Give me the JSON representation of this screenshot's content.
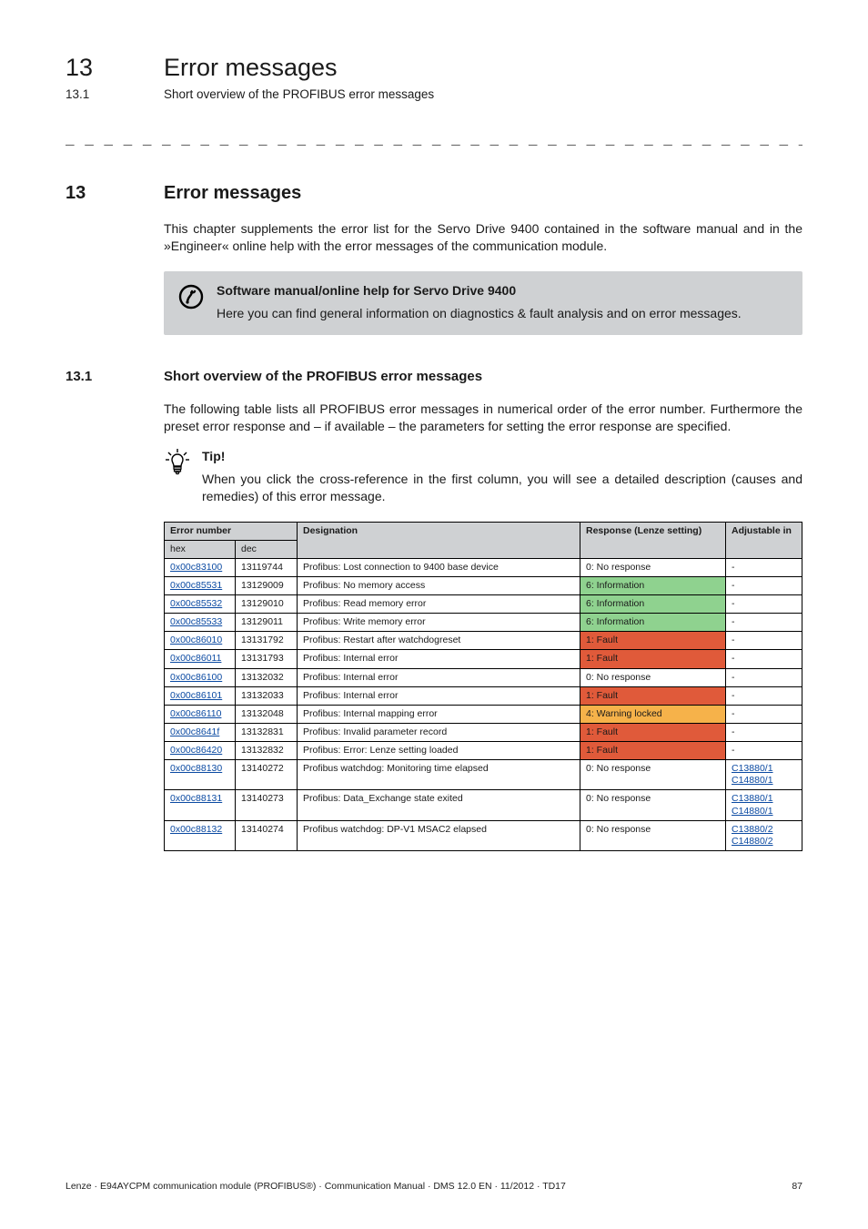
{
  "header": {
    "chapter_num": "13",
    "chapter_title": "Error messages",
    "sub_num": "13.1",
    "sub_title": "Short overview of the PROFIBUS error messages"
  },
  "dashes": "_ _ _ _ _ _ _ _ _ _ _ _ _ _ _ _ _ _ _ _ _ _ _ _ _ _ _ _ _ _ _ _ _ _ _ _ _ _ _ _ _ _ _ _ _ _ _ _ _ _ _ _ _ _ _ _ _ _ _ _ _ _ _ _",
  "section": {
    "num": "13",
    "title": "Error messages",
    "para": "This chapter supplements the error list for the Servo Drive 9400 contained in the software manual and in the »Engineer« online help with the error messages of the communication module."
  },
  "callout": {
    "title": "Software manual/online help for Servo Drive 9400",
    "body": "Here you can find general information on diagnostics & fault analysis and on error messages."
  },
  "subsection": {
    "num": "13.1",
    "title": "Short overview of the PROFIBUS error messages",
    "para": "The following table lists all PROFIBUS error messages in numerical order of the error number. Furthermore the preset error response and – if available – the parameters for setting the error response are specified."
  },
  "tip": {
    "label": "Tip!",
    "body": "When you click the cross-reference in the first column, you will see a detailed description (causes and remedies) of this error message."
  },
  "table": {
    "headers": {
      "error_number": "Error number",
      "hex": "hex",
      "dec": "dec",
      "designation": "Designation",
      "response": "Response (Lenze setting)",
      "adjustable": "Adjustable in"
    },
    "rows": [
      {
        "hex": "0x00c83100",
        "dec": "13119744",
        "designation": "Profibus: Lost connection to 9400 base device",
        "response": "0: No response",
        "resp_class": "resp-none",
        "adjustable": [
          "-"
        ]
      },
      {
        "hex": "0x00c85531",
        "dec": "13129009",
        "designation": "Profibus: No memory access",
        "response": "6: Information",
        "resp_class": "resp-info",
        "adjustable": [
          "-"
        ]
      },
      {
        "hex": "0x00c85532",
        "dec": "13129010",
        "designation": "Profibus: Read memory error",
        "response": "6: Information",
        "resp_class": "resp-info",
        "adjustable": [
          "-"
        ]
      },
      {
        "hex": "0x00c85533",
        "dec": "13129011",
        "designation": "Profibus: Write memory error",
        "response": "6: Information",
        "resp_class": "resp-info",
        "adjustable": [
          "-"
        ]
      },
      {
        "hex": "0x00c86010",
        "dec": "13131792",
        "designation": "Profibus: Restart after watchdogreset",
        "response": "1: Fault",
        "resp_class": "resp-fault",
        "adjustable": [
          "-"
        ]
      },
      {
        "hex": "0x00c86011",
        "dec": "13131793",
        "designation": "Profibus: Internal error",
        "response": "1: Fault",
        "resp_class": "resp-fault",
        "adjustable": [
          "-"
        ]
      },
      {
        "hex": "0x00c86100",
        "dec": "13132032",
        "designation": "Profibus: Internal error",
        "response": "0: No response",
        "resp_class": "resp-none",
        "adjustable": [
          "-"
        ]
      },
      {
        "hex": "0x00c86101",
        "dec": "13132033",
        "designation": "Profibus: Internal error",
        "response": "1: Fault",
        "resp_class": "resp-fault",
        "adjustable": [
          "-"
        ]
      },
      {
        "hex": "0x00c86110",
        "dec": "13132048",
        "designation": "Profibus: Internal mapping error",
        "response": "4: Warning locked",
        "resp_class": "resp-warn",
        "adjustable": [
          "-"
        ]
      },
      {
        "hex": "0x00c8641f",
        "dec": "13132831",
        "designation": "Profibus: Invalid parameter record",
        "response": "1: Fault",
        "resp_class": "resp-fault",
        "adjustable": [
          "-"
        ]
      },
      {
        "hex": "0x00c86420",
        "dec": "13132832",
        "designation": "Profibus: Error: Lenze setting loaded",
        "response": "1: Fault",
        "resp_class": "resp-fault",
        "adjustable": [
          "-"
        ]
      },
      {
        "hex": "0x00c88130",
        "dec": "13140272",
        "designation": "Profibus watchdog: Monitoring time elapsed",
        "response": "0: No response",
        "resp_class": "resp-none",
        "adjustable": [
          "C13880/1",
          "C14880/1"
        ]
      },
      {
        "hex": "0x00c88131",
        "dec": "13140273",
        "designation": "Profibus: Data_Exchange state exited",
        "response": "0: No response",
        "resp_class": "resp-none",
        "adjustable": [
          "C13880/1",
          "C14880/1"
        ]
      },
      {
        "hex": "0x00c88132",
        "dec": "13140274",
        "designation": "Profibus watchdog: DP-V1 MSAC2 elapsed",
        "response": "0: No response",
        "resp_class": "resp-none",
        "adjustable": [
          "C13880/2",
          "C14880/2"
        ]
      }
    ]
  },
  "footer": {
    "left": "Lenze · E94AYCPM communication module (PROFIBUS®) · Communication Manual · DMS 12.0 EN · 11/2012 · TD17",
    "right": "87"
  }
}
